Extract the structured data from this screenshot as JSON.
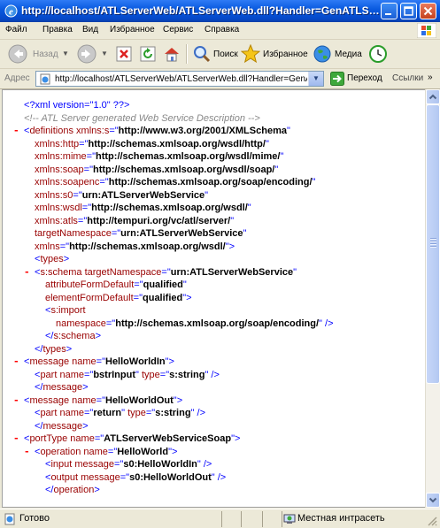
{
  "window": {
    "title": "http://localhost/ATLServerWeb/ATLServerWeb.dll?Handler=GenATLServer..."
  },
  "menu": {
    "items": [
      "Файл",
      "Правка",
      "Вид",
      "Избранное",
      "Сервис",
      "Справка"
    ]
  },
  "toolbar": {
    "back_label": "Назад",
    "search_label": "Поиск",
    "favorites_label": "Избранное",
    "media_label": "Медиа"
  },
  "address": {
    "label": "Адрес",
    "url": "http://localhost/ATLServerWeb/ATLServerWeb.dll?Handler=GenATLSe",
    "go_label": "Переход",
    "links_label": "Ссылки",
    "links_chevron": "»"
  },
  "content": {
    "lines": [
      {
        "indent": 0,
        "type": "pi",
        "text": "xml version=\"1.0\" ?"
      },
      {
        "indent": 0,
        "type": "comment",
        "text": "<!--  ATL Server generated Web Service Description  -->"
      },
      {
        "indent": 0,
        "type": "open",
        "minus": true,
        "tag": "definitions",
        "attrs": [
          [
            "xmlns:s",
            "http://www.w3.org/2001/XMLSchema"
          ]
        ]
      },
      {
        "indent": 1,
        "type": "attr",
        "name": "xmlns:http",
        "value": "http://schemas.xmlsoap.org/wsdl/http/"
      },
      {
        "indent": 1,
        "type": "attr",
        "name": "xmlns:mime",
        "value": "http://schemas.xmlsoap.org/wsdl/mime/"
      },
      {
        "indent": 1,
        "type": "attr",
        "name": "xmlns:soap",
        "value": "http://schemas.xmlsoap.org/wsdl/soap/"
      },
      {
        "indent": 1,
        "type": "attr",
        "name": "xmlns:soapenc",
        "value": "http://schemas.xmlsoap.org/soap/encoding/"
      },
      {
        "indent": 1,
        "type": "attr",
        "name": "xmlns:s0",
        "value": "urn:ATLServerWebService"
      },
      {
        "indent": 1,
        "type": "attr",
        "name": "xmlns:wsdl",
        "value": "http://schemas.xmlsoap.org/wsdl/"
      },
      {
        "indent": 1,
        "type": "attr",
        "name": "xmlns:atls",
        "value": "http://tempuri.org/vc/atl/server/"
      },
      {
        "indent": 1,
        "type": "attr",
        "name": "targetNamespace",
        "value": "urn:ATLServerWebService"
      },
      {
        "indent": 1,
        "type": "attr",
        "name": "xmlns",
        "value": "http://schemas.xmlsoap.org/wsdl/",
        "end": ">"
      },
      {
        "indent": 1,
        "type": "open",
        "minus": false,
        "tag": "types",
        "attrs": []
      },
      {
        "indent": 1,
        "type": "open",
        "minus": true,
        "tag": "s:schema",
        "attrs": [
          [
            "targetNamespace",
            "urn:ATLServerWebService"
          ]
        ],
        "noend": true
      },
      {
        "indent": 2,
        "type": "attr",
        "name": "attributeFormDefault",
        "value": "qualified"
      },
      {
        "indent": 2,
        "type": "attr",
        "name": "elementFormDefault",
        "value": "qualified",
        "end": ">"
      },
      {
        "indent": 2,
        "type": "open",
        "minus": false,
        "tag": "s:import",
        "attrs": [],
        "noend": true
      },
      {
        "indent": 3,
        "type": "attr",
        "name": "namespace",
        "value": "http://schemas.xmlsoap.org/soap/encoding/",
        "end": " />"
      },
      {
        "indent": 2,
        "type": "close",
        "tag": "s:schema"
      },
      {
        "indent": 1,
        "type": "close",
        "tag": "types"
      },
      {
        "indent": 0,
        "type": "open",
        "minus": true,
        "tag": "message",
        "attrs": [
          [
            "name",
            "HelloWorldIn"
          ]
        ]
      },
      {
        "indent": 1,
        "type": "selfclose",
        "tag": "part",
        "attrs": [
          [
            "name",
            "bstrInput"
          ],
          [
            "type",
            "s:string"
          ]
        ]
      },
      {
        "indent": 1,
        "type": "close",
        "tag": "message"
      },
      {
        "indent": 0,
        "type": "open",
        "minus": true,
        "tag": "message",
        "attrs": [
          [
            "name",
            "HelloWorldOut"
          ]
        ]
      },
      {
        "indent": 1,
        "type": "selfclose",
        "tag": "part",
        "attrs": [
          [
            "name",
            "return"
          ],
          [
            "type",
            "s:string"
          ]
        ]
      },
      {
        "indent": 1,
        "type": "close",
        "tag": "message"
      },
      {
        "indent": 0,
        "type": "open",
        "minus": true,
        "tag": "portType",
        "attrs": [
          [
            "name",
            "ATLServerWebServiceSoap"
          ]
        ]
      },
      {
        "indent": 1,
        "type": "open",
        "minus": true,
        "tag": "operation",
        "attrs": [
          [
            "name",
            "HelloWorld"
          ]
        ]
      },
      {
        "indent": 2,
        "type": "selfclose",
        "tag": "input",
        "attrs": [
          [
            "message",
            "s0:HelloWorldIn"
          ]
        ]
      },
      {
        "indent": 2,
        "type": "selfclose",
        "tag": "output",
        "attrs": [
          [
            "message",
            "s0:HelloWorldOut"
          ]
        ]
      },
      {
        "indent": 2,
        "type": "close",
        "tag": "operation"
      }
    ]
  },
  "status": {
    "text": "Готово",
    "zone": "Местная интрасеть"
  }
}
